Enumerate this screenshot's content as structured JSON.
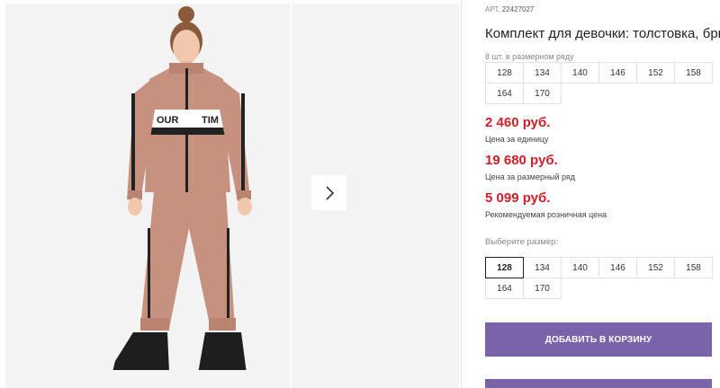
{
  "sku": {
    "label": "АРТ.",
    "value": "22427027"
  },
  "title": "Комплект для девочки: толстовка, брюки",
  "pack_note": "8 шт. в размерном ряду",
  "pack_sizes": [
    "128",
    "134",
    "140",
    "146",
    "152",
    "158",
    "164",
    "170"
  ],
  "prices": [
    {
      "amount": "2 460 руб.",
      "caption": "Цена за единицу"
    },
    {
      "amount": "19 680 руб.",
      "caption": "Цена за размерный ряд"
    },
    {
      "amount": "5 099 руб.",
      "caption": "Рекомендуемая розничная цена"
    }
  ],
  "size_select": {
    "label": "Выберите размер:",
    "options": [
      "128",
      "134",
      "140",
      "146",
      "152",
      "158",
      "164",
      "170"
    ],
    "selected": "128"
  },
  "add_to_cart_label": "ДОБАВИТЬ В КОРЗИНУ",
  "gallery": {
    "next_icon": "chevron-right-icon"
  },
  "colors": {
    "accent": "#7b63a9",
    "price": "#d21e2b",
    "suit": "#c6917f"
  }
}
